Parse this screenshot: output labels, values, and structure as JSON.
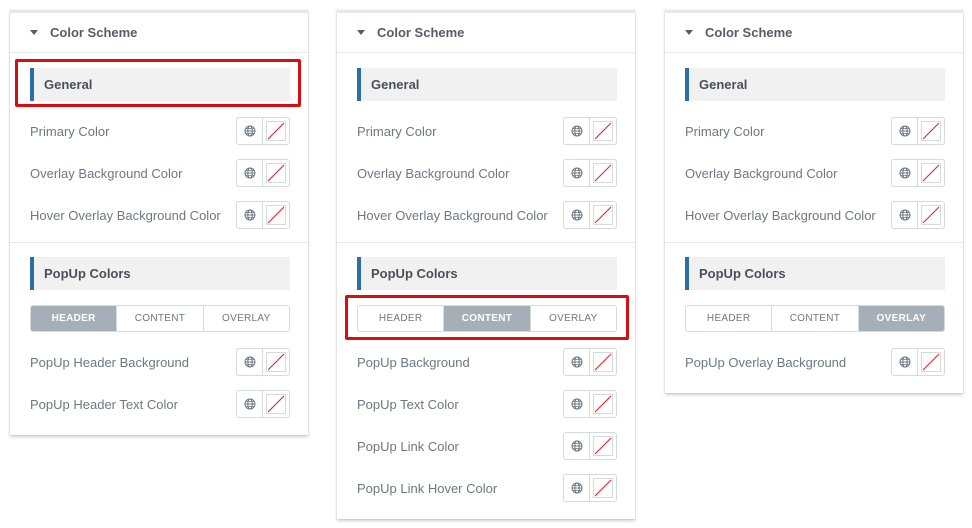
{
  "accent_color": "#2a70a6",
  "highlight_color": "#d40f0f",
  "active_tab_color": "#a4afb7",
  "panels": [
    {
      "section_title": "Color Scheme",
      "general_heading": "General",
      "general_controls": [
        {
          "label": "Primary Color"
        },
        {
          "label": "Overlay Background Color"
        },
        {
          "label": "Hover Overlay Background Color"
        }
      ],
      "popup_heading": "PopUp Colors",
      "tabs": [
        "HEADER",
        "CONTENT",
        "OVERLAY"
      ],
      "active_tab": "HEADER",
      "popup_controls": [
        {
          "label": "PopUp Header Background"
        },
        {
          "label": "PopUp Header Text Color"
        }
      ]
    },
    {
      "section_title": "Color Scheme",
      "general_heading": "General",
      "general_controls": [
        {
          "label": "Primary Color"
        },
        {
          "label": "Overlay Background Color"
        },
        {
          "label": "Hover Overlay Background Color"
        }
      ],
      "popup_heading": "PopUp Colors",
      "tabs": [
        "HEADER",
        "CONTENT",
        "OVERLAY"
      ],
      "active_tab": "CONTENT",
      "popup_controls": [
        {
          "label": "PopUp Background"
        },
        {
          "label": "PopUp Text Color"
        },
        {
          "label": "PopUp Link Color"
        },
        {
          "label": "PopUp Link Hover Color"
        }
      ]
    },
    {
      "section_title": "Color Scheme",
      "general_heading": "General",
      "general_controls": [
        {
          "label": "Primary Color"
        },
        {
          "label": "Overlay Background Color"
        },
        {
          "label": "Hover Overlay Background Color"
        }
      ],
      "popup_heading": "PopUp Colors",
      "tabs": [
        "HEADER",
        "CONTENT",
        "OVERLAY"
      ],
      "active_tab": "OVERLAY",
      "popup_controls": [
        {
          "label": "PopUp Overlay Background"
        }
      ]
    }
  ],
  "icons": {
    "global": "globe-icon",
    "swatch": "no-color-swatch-icon",
    "collapse": "caret-down-icon"
  }
}
